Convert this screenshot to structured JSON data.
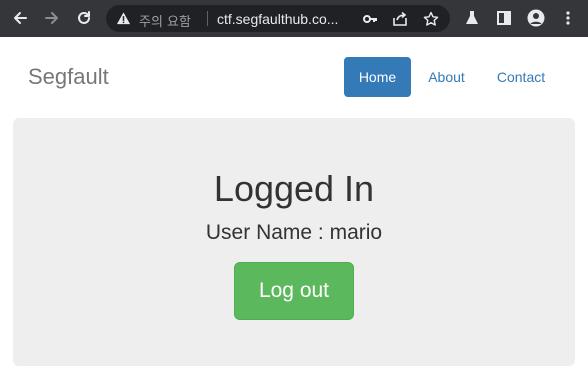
{
  "browser": {
    "security_label": "주의 요함",
    "url": "ctf.segfaulthub.co..."
  },
  "navbar": {
    "brand": "Segfault",
    "items": [
      {
        "label": "Home",
        "active": true
      },
      {
        "label": "About",
        "active": false
      },
      {
        "label": "Contact",
        "active": false
      }
    ]
  },
  "main": {
    "title": "Logged In",
    "user_line": "User Name : mario",
    "logout_label": "Log out"
  },
  "colors": {
    "toolbar": "#35363a",
    "omnibox": "#202124",
    "primary": "#337ab7",
    "success": "#5cb85c",
    "jumbotron": "#eeeeee"
  }
}
